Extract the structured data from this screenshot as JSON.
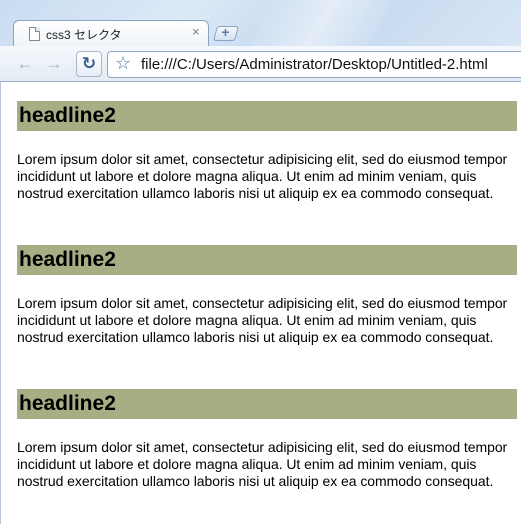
{
  "tab": {
    "title": "css3 セレクタ",
    "close_glyph": "×",
    "new_tab_glyph": "+"
  },
  "toolbar": {
    "back_glyph": "←",
    "forward_glyph": "→",
    "reload_glyph": "↻",
    "star_glyph": "☆",
    "url": "file:///C:/Users/Administrator/Desktop/Untitled-2.html"
  },
  "page": {
    "sections": [
      {
        "headline": "headline2",
        "text": "Lorem ipsum dolor sit amet, consectetur adipisicing elit, sed do eiusmod tempor incididunt ut labore et dolore magna aliqua. Ut enim ad minim veniam, quis nostrud exercitation ullamco laboris nisi ut aliquip ex ea commodo consequat."
      },
      {
        "headline": "headline2",
        "text": "Lorem ipsum dolor sit amet, consectetur adipisicing elit, sed do eiusmod tempor incididunt ut labore et dolore magna aliqua. Ut enim ad minim veniam, quis nostrud exercitation ullamco laboris nisi ut aliquip ex ea commodo consequat."
      },
      {
        "headline": "headline2",
        "text": "Lorem ipsum dolor sit amet, consectetur adipisicing elit, sed do eiusmod tempor incididunt ut labore et dolore magna aliqua. Ut enim ad minim veniam, quis nostrud exercitation ullamco laboris nisi ut aliquip ex ea commodo consequat."
      }
    ]
  },
  "colors": {
    "headline_bg": "#a8ae84",
    "tabstrip_bg": "#c9dcf1"
  },
  "icons": [
    "page-icon",
    "close-icon",
    "new-tab-icon",
    "back-icon",
    "forward-icon",
    "reload-icon",
    "bookmark-star-icon"
  ]
}
